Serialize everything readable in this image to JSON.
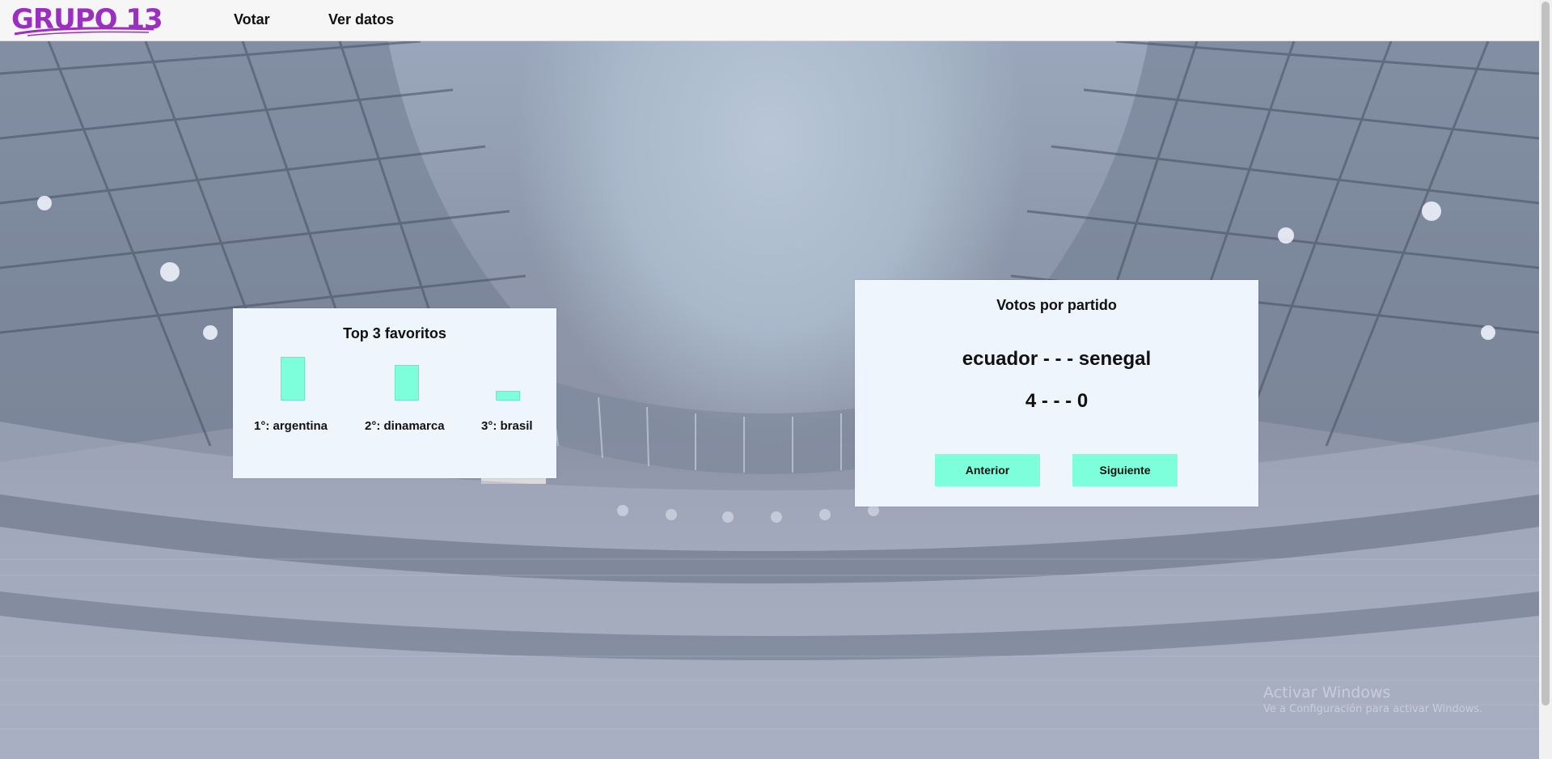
{
  "app": {
    "logo_text": "GRUPO 13",
    "brand_color": "#9b2fbf"
  },
  "nav": {
    "items": [
      {
        "label": "Votar"
      },
      {
        "label": "Ver datos"
      }
    ]
  },
  "top3": {
    "title": "Top 3 favoritos",
    "bar_color": "#7effdb",
    "entries": [
      {
        "label": "1°: argentina",
        "relative_value": 1.0
      },
      {
        "label": "2°: dinamarca",
        "relative_value": 0.8
      },
      {
        "label": "3°: brasil",
        "relative_value": 0.2
      }
    ]
  },
  "votes": {
    "title": "Votos por partido",
    "teams": "ecuador - - - senegal",
    "score": "4 - - - 0",
    "prev_label": "Anterior",
    "next_label": "Siguiente",
    "button_color": "#7effdb"
  },
  "watermark": {
    "title": "Activar Windows",
    "subtitle": "Ve a Configuración para activar Windows."
  }
}
